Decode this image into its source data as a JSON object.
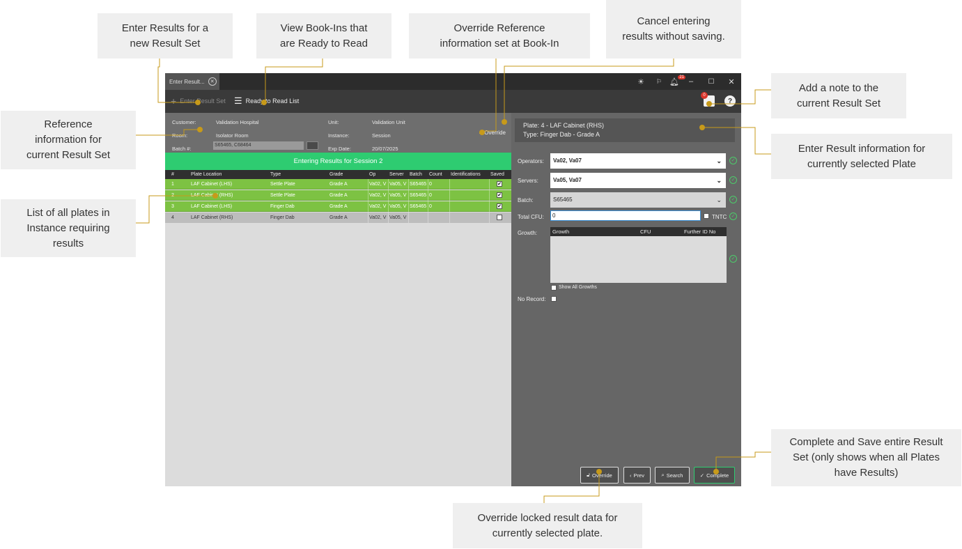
{
  "callouts": {
    "new_result_set": "Enter Results for a\nnew Result Set",
    "ready_to_read": "View Book-Ins that\nare Ready to Read",
    "override_reference": "Override Reference\ninformation set at Book-In",
    "cancel": "Cancel entering\nresults without saving.",
    "add_note": "Add a note to the\ncurrent Result Set",
    "reference_info": "Reference\ninformation for\ncurrent Result Set",
    "enter_result_info": "Enter Result information for\ncurrently selected Plate",
    "plate_list": "List of all plates in\nInstance requiring\nresults",
    "complete_save": "Complete and Save entire Result\nSet (only shows when all Plates\nhave Results)",
    "override_locked": "Override locked result data for\ncurrently selected plate."
  },
  "window": {
    "tab_label": "Enter Result...",
    "bell_count": "21",
    "note_count": "0"
  },
  "toolbar": {
    "enter_result_set": "Enter Result Set",
    "ready_to_read": "Ready to Read List"
  },
  "reference": {
    "customer_label": "Customer:",
    "customer_value": "Validation Hospital",
    "room_label": "Room:",
    "room_value": "Isolator Room",
    "batch_label": "Batch #:",
    "batch_value": "S65465, C68464",
    "unit_label": "Unit:",
    "unit_value": "Validation Unit",
    "instance_label": "Instance:",
    "instance_value": "Session",
    "exp_label": "Exp Date:",
    "exp_value": "20/07/2025",
    "override": "Override"
  },
  "banner": "Entering Results for Session 2",
  "table": {
    "headers": [
      "#",
      "Plate Location",
      "Type",
      "Grade",
      "Op",
      "Server",
      "Batch",
      "Count",
      "Identifications",
      "Saved"
    ],
    "rows": [
      {
        "num": "1",
        "location": "LAF Cabinet (LHS)",
        "type": "Settle Plate",
        "grade": "Grade A",
        "op": "Va02, V",
        "server": "Va05, V",
        "batch": "S65465",
        "count": "0",
        "ident": "",
        "saved": "✔"
      },
      {
        "num": "2",
        "location": "LAF Cabinet (RHS)",
        "type": "Settle Plate",
        "grade": "Grade A",
        "op": "Va02, V",
        "server": "Va05, V",
        "batch": "S65465",
        "count": "0",
        "ident": "",
        "saved": "✔"
      },
      {
        "num": "3",
        "location": "LAF Cabinet (LHS)",
        "type": "Finger Dab",
        "grade": "Grade A",
        "op": "Va02, V",
        "server": "Va05, V",
        "batch": "S65465",
        "count": "0",
        "ident": "",
        "saved": "✔"
      },
      {
        "num": "4",
        "location": "LAF Cabinet (RHS)",
        "type": "Finger Dab",
        "grade": "Grade A",
        "op": "Va02, V",
        "server": "Va05, V",
        "batch": "",
        "count": "",
        "ident": "",
        "saved": ""
      }
    ]
  },
  "plate": {
    "line1": "Plate:  4  -  LAF Cabinet (RHS)",
    "line2": "Type:  Finger Dab  -  Grade A"
  },
  "form": {
    "operators_label": "Operators:",
    "operators_value": "Va02, Va07",
    "servers_label": "Servers:",
    "servers_value": "Va05, Va07",
    "batch_label": "Batch:",
    "batch_value": "S65465",
    "total_cfu_label": "Total CFU:",
    "total_cfu_value": "0",
    "tntc_label": "TNTC",
    "growth_label": "Growth:",
    "growth_headers": [
      "Growth",
      "CFU",
      "Further ID No"
    ],
    "show_all_growths": "Show All Growths",
    "no_record_label": "No Record:"
  },
  "buttons": {
    "override": "Override",
    "prev": "Prev",
    "search": "Search",
    "complete": "Complete"
  },
  "colors": {
    "accent_line": "#c79a1a",
    "saved_row": "#7dc243",
    "banner": "#2ecc71"
  }
}
